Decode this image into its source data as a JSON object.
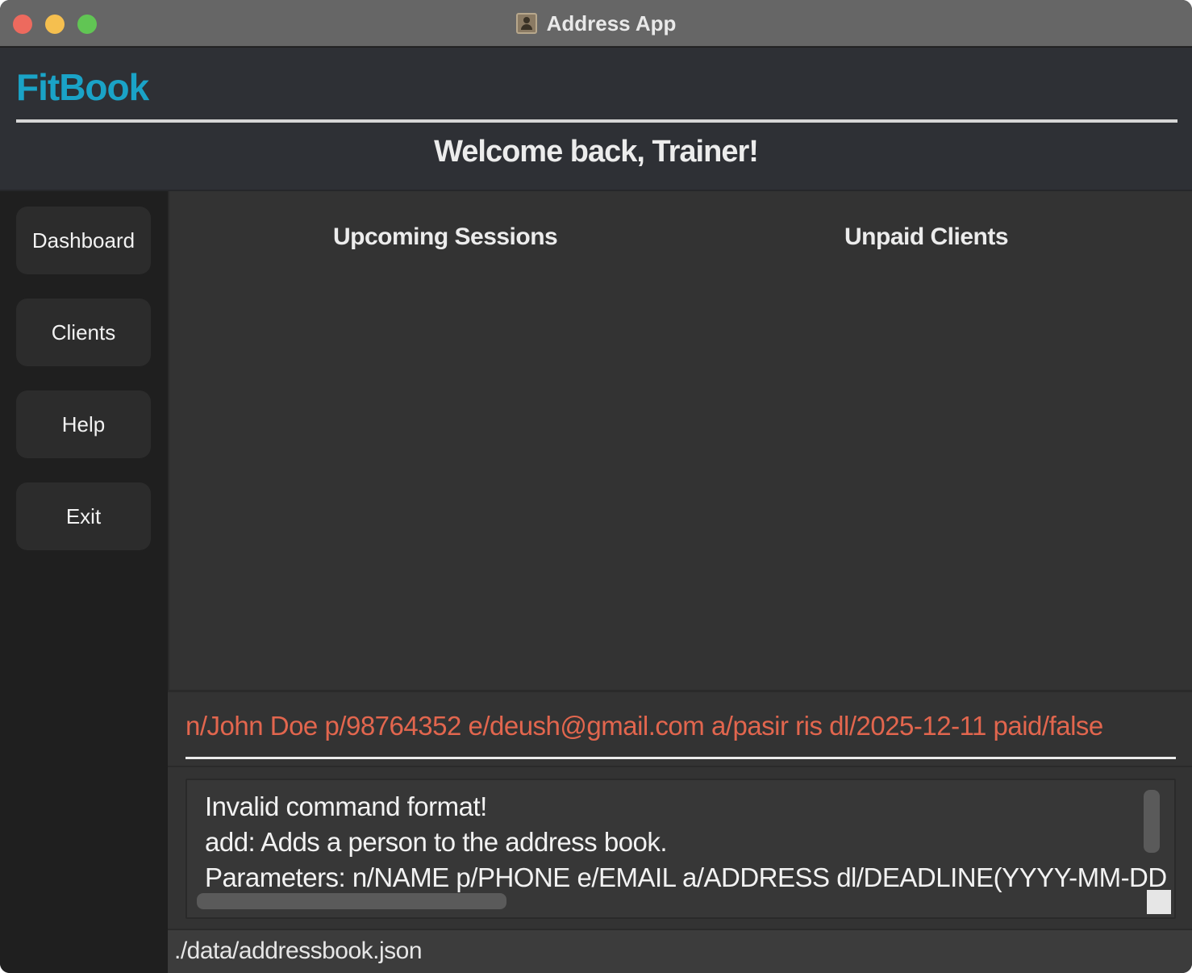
{
  "window": {
    "title": "Address App"
  },
  "header": {
    "brand": "FitBook",
    "welcome": "Welcome back, Trainer!"
  },
  "sidebar": {
    "items": [
      {
        "label": "Dashboard"
      },
      {
        "label": "Clients"
      },
      {
        "label": "Help"
      },
      {
        "label": "Exit"
      }
    ]
  },
  "main": {
    "upcoming_sessions_title": "Upcoming Sessions",
    "unpaid_clients_title": "Unpaid Clients"
  },
  "command": {
    "value": "n/John Doe p/98764352 e/deush@gmail.com a/pasir ris dl/2025-12-11 paid/false",
    "error_color": "#e2664e"
  },
  "result": {
    "lines": [
      "Invalid command format!",
      "add: Adds a person to the address book.",
      "Parameters: n/NAME p/PHONE e/EMAIL a/ADDRESS dl/DEADLINE(YYYY-MM-DD"
    ]
  },
  "status": {
    "file_path": "./data/addressbook.json"
  },
  "colors": {
    "brand": "#1aa3c7",
    "background": "#333333",
    "sidebar": "#1f1f1f"
  }
}
